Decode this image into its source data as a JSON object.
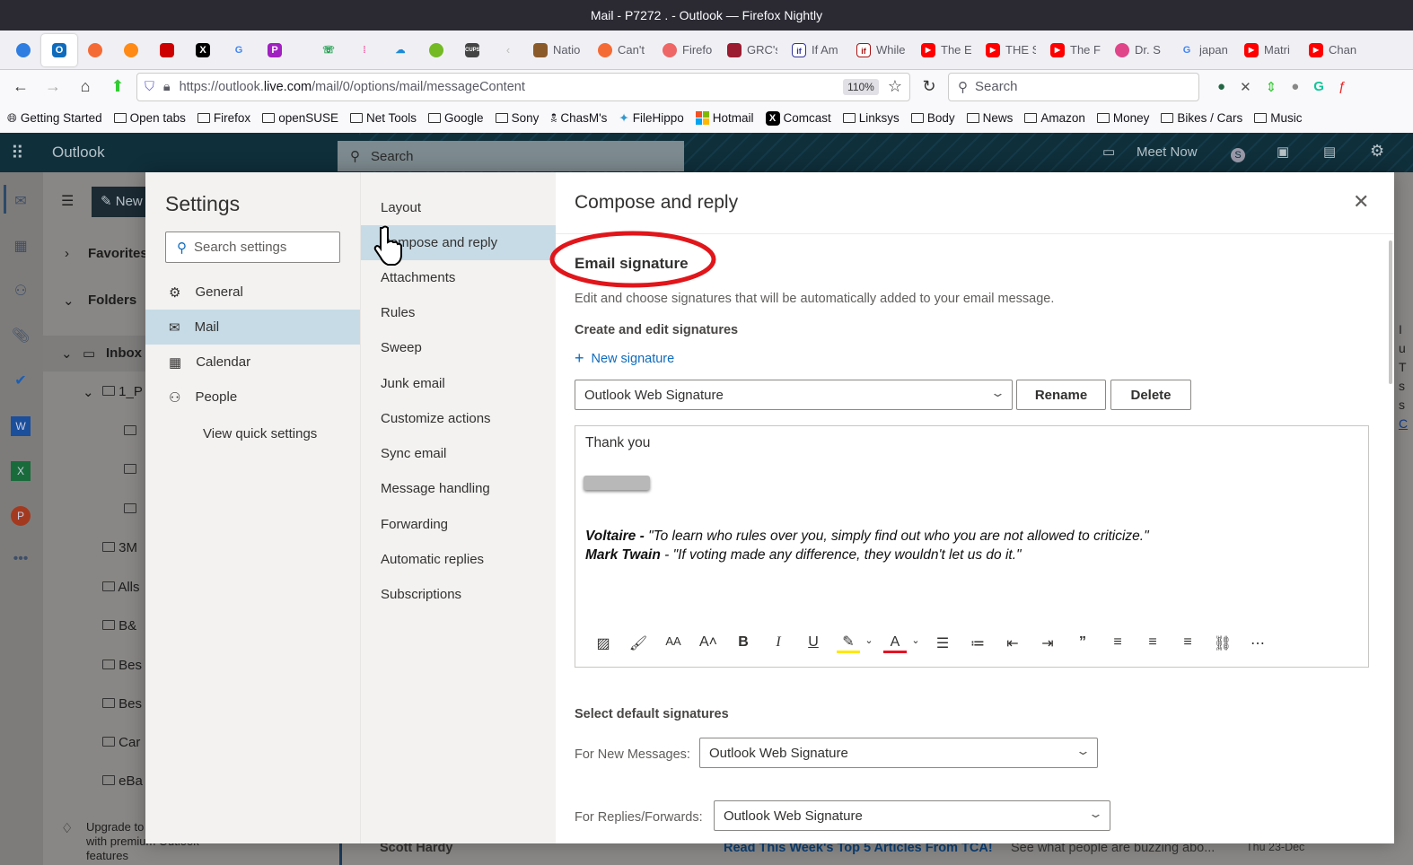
{
  "browser": {
    "window_title": "Mail - P7272 . - Outlook — Firefox Nightly",
    "tabs": [
      {
        "label": "Natio",
        "icon": "image-icon"
      },
      {
        "label": "Can't",
        "icon": "firefox-icon"
      },
      {
        "label": "Firefo",
        "icon": "firefox-icon"
      },
      {
        "label": "GRC's",
        "icon": "grc-icon"
      },
      {
        "label": "If Am",
        "icon": "if-icon"
      },
      {
        "label": "While",
        "icon": "if-icon"
      },
      {
        "label": "The E",
        "icon": "youtube-icon"
      },
      {
        "label": "THE S",
        "icon": "youtube-icon"
      },
      {
        "label": "The F",
        "icon": "youtube-icon"
      },
      {
        "label": "Dr. S",
        "icon": "dr-icon"
      },
      {
        "label": "japan",
        "icon": "google-icon"
      },
      {
        "label": "Matri",
        "icon": "youtube-icon"
      },
      {
        "label": "Chan",
        "icon": "youtube-icon"
      }
    ],
    "url_prefix": "https://outlook.",
    "url_domain": "live.com",
    "url_path": "/mail/0/options/mail/messageContent",
    "zoom": "110%",
    "search_placeholder": "Search",
    "bookmarks": [
      "Getting Started",
      "Open tabs",
      "Firefox",
      "openSUSE",
      "Net Tools",
      "Google",
      "Sony",
      "ChasM's",
      "FileHippo",
      "Hotmail",
      "Comcast",
      "Linksys",
      "Body",
      "News",
      "Amazon",
      "Money",
      "Bikes / Cars",
      "Music"
    ]
  },
  "outlook": {
    "app_name": "Outlook",
    "search_placeholder": "Search",
    "meet_now": "Meet Now",
    "new_message": "New",
    "folder_pane": {
      "favorites": "Favorites",
      "folders": "Folders",
      "inbox": "Inbox",
      "subfolder": "1_P",
      "folders_list": [
        "3M",
        "Alls",
        "B&",
        "Bes",
        "Bes",
        "Car",
        "eBa"
      ],
      "upgrade": "Upgrade to",
      "upgrade2": "with premium Outlook",
      "upgrade3": "features"
    },
    "message_row": {
      "sender": "Scott Hardy",
      "subject": "Read This Week's Top 5 Articles From TCA!",
      "preview": "See what people are buzzing abo...",
      "date": "Thu 23-Dec"
    }
  },
  "settings": {
    "title": "Settings",
    "search_placeholder": "Search settings",
    "nav": [
      {
        "label": "General",
        "icon": "gear-icon"
      },
      {
        "label": "Mail",
        "icon": "mail-icon",
        "selected": true
      },
      {
        "label": "Calendar",
        "icon": "calendar-icon"
      },
      {
        "label": "People",
        "icon": "people-icon"
      }
    ],
    "view_quick_settings": "View quick settings",
    "mail_sections": [
      "Layout",
      "Compose and reply",
      "Attachments",
      "Rules",
      "Sweep",
      "Junk email",
      "Customize actions",
      "Sync email",
      "Message handling",
      "Forwarding",
      "Automatic replies",
      "Subscriptions"
    ],
    "selected_section": "Compose and reply",
    "page": {
      "title": "Compose and reply",
      "section_title": "Email signature",
      "description": "Edit and choose signatures that will be automatically added to your email message.",
      "create_label": "Create and edit signatures",
      "new_signature": "New signature",
      "selected_signature": "Outlook Web Signature",
      "rename": "Rename",
      "delete": "Delete",
      "signature_body": {
        "line1": "Thank you",
        "quote1_author": "Voltaire - ",
        "quote1_text": "\"To learn who rules over you, simply find out who you are not allowed to criticize.\"",
        "quote2_author": "Mark Twain",
        "quote2_text": " - \"If voting made any difference, they wouldn't let us do it.\""
      },
      "default_label": "Select default signatures",
      "new_messages_label": "For New Messages:",
      "new_messages_value": "Outlook Web Signature",
      "replies_label": "For Replies/Forwards:",
      "replies_value": "Outlook Web Signature"
    }
  },
  "colors": {
    "accent": "#0f6cbd",
    "annotation": "#e0161b",
    "selected_nav": "#c7dbe6"
  }
}
